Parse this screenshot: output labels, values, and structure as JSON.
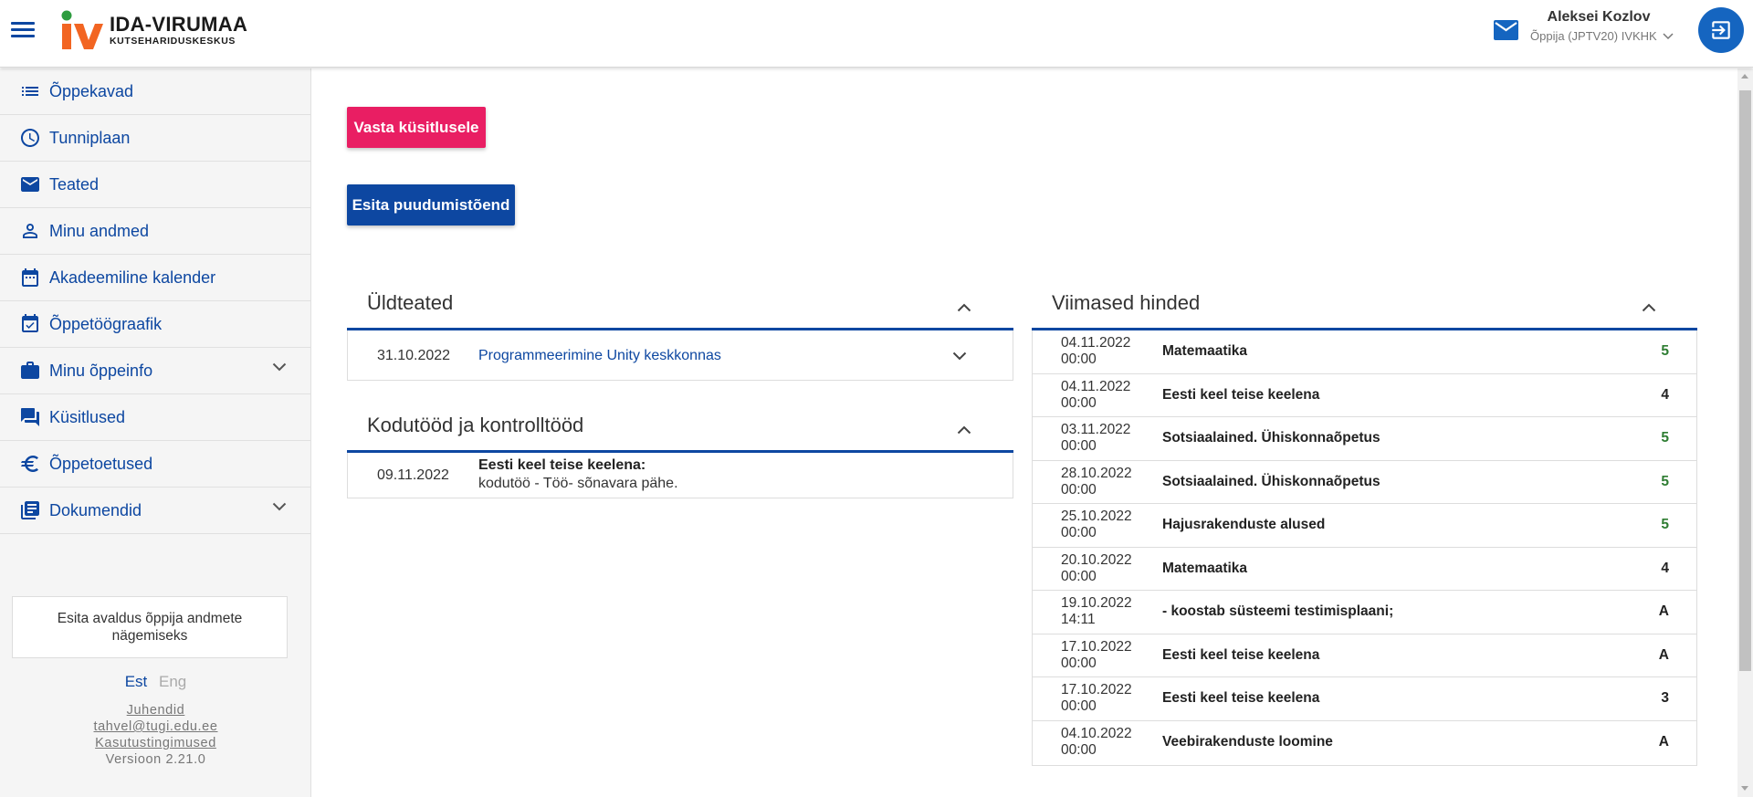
{
  "brand": {
    "title": "IDA-VIRUMAA",
    "subtitle": "KUTSEHARIDUSKESKUS",
    "colors": {
      "orange": "#f26522",
      "green": "#2e9c3f"
    }
  },
  "header": {
    "user_name": "Aleksei Kozlov",
    "user_role": "Õppija (JPTV20) IVKHK"
  },
  "sidebar": {
    "items": [
      {
        "label": "Õppekavad",
        "icon": "list-icon"
      },
      {
        "label": "Tunniplaan",
        "icon": "clock-icon"
      },
      {
        "label": "Teated",
        "icon": "mail-icon"
      },
      {
        "label": "Minu andmed",
        "icon": "person-icon"
      },
      {
        "label": "Akadeemiline kalender",
        "icon": "calendar-icon"
      },
      {
        "label": "Õppetöögraafik",
        "icon": "calendar-check-icon"
      },
      {
        "label": "Minu õppeinfo",
        "icon": "briefcase-icon",
        "expandable": true
      },
      {
        "label": "Küsitlused",
        "icon": "forum-icon"
      },
      {
        "label": "Õppetoetused",
        "icon": "euro-icon"
      },
      {
        "label": "Dokumendid",
        "icon": "library-books-icon",
        "expandable": true
      }
    ],
    "request_label": "Esita avaldus õppija andmete nägemiseks",
    "lang_est": "Est",
    "lang_eng": "Eng",
    "footer": {
      "guides": "Juhendid",
      "email": "tahvel@tugi.edu.ee",
      "terms": "Kasutustingimused",
      "version": "Versioon 2.21.0"
    }
  },
  "main": {
    "survey_button": "Vasta küsitlusele",
    "absence_button": "Esita puudumistõend",
    "announcements": {
      "title": "Üldteated",
      "items": [
        {
          "date": "31.10.2022",
          "title": "Programmeerimine Unity keskkonnas"
        }
      ]
    },
    "homework": {
      "title": "Kodutööd ja kontrolltööd",
      "items": [
        {
          "date": "09.11.2022",
          "subject": "Eesti keel teise keelena:",
          "description": "kodutöö - Töö- sõnavara pähe."
        }
      ]
    },
    "grades": {
      "title": "Viimased hinded",
      "items": [
        {
          "date": "04.11.2022",
          "time": "00:00",
          "subject": "Matemaatika",
          "grade": "5",
          "color": "#2e7d32"
        },
        {
          "date": "04.11.2022",
          "time": "00:00",
          "subject": "Eesti keel teise keelena",
          "grade": "4",
          "color": "#222222"
        },
        {
          "date": "03.11.2022",
          "time": "00:00",
          "subject": "Sotsiaalained. Ühiskonnaõpetus",
          "grade": "5",
          "color": "#2e7d32"
        },
        {
          "date": "28.10.2022",
          "time": "00:00",
          "subject": "Sotsiaalained. Ühiskonnaõpetus",
          "grade": "5",
          "color": "#2e7d32"
        },
        {
          "date": "25.10.2022",
          "time": "00:00",
          "subject": "Hajusrakenduste alused",
          "grade": "5",
          "color": "#2e7d32"
        },
        {
          "date": "20.10.2022",
          "time": "00:00",
          "subject": "Matemaatika",
          "grade": "4",
          "color": "#222222"
        },
        {
          "date": "19.10.2022",
          "time": "14:11",
          "subject": "- koostab süsteemi testimisplaani;",
          "grade": "A",
          "color": "#222222"
        },
        {
          "date": "17.10.2022",
          "time": "00:00",
          "subject": "Eesti keel teise keelena",
          "grade": "A",
          "color": "#222222"
        },
        {
          "date": "17.10.2022",
          "time": "00:00",
          "subject": "Eesti keel teise keelena",
          "grade": "3",
          "color": "#222222"
        },
        {
          "date": "04.10.2022",
          "time": "00:00",
          "subject": "Veebirakenduste loomine",
          "grade": "A",
          "color": "#222222"
        }
      ]
    }
  }
}
